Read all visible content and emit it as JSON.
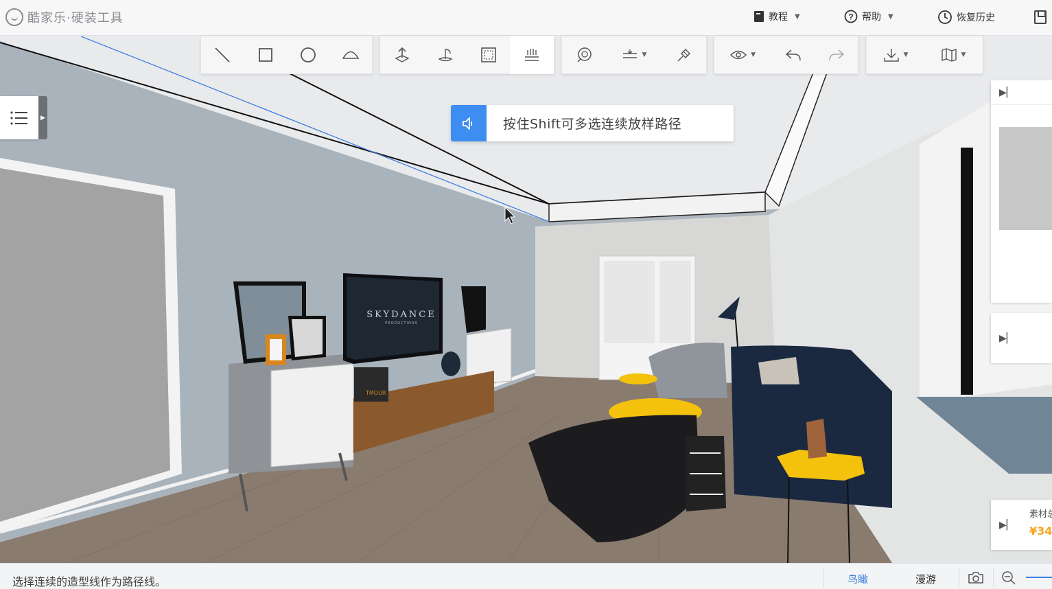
{
  "app": {
    "brand": "酷家乐",
    "dot": "·",
    "tool_name": "硬装工具"
  },
  "top_menu": {
    "tutorial": "教程",
    "help": "帮助",
    "history": "恢复历史"
  },
  "toolbar": {
    "groups": [
      {
        "id": "draw",
        "items": [
          "line-tool-icon",
          "rectangle-tool-icon",
          "circle-tool-icon",
          "arc-tool-icon"
        ]
      },
      {
        "id": "edit",
        "items": [
          "push-pull-icon",
          "rotate-extrude-icon",
          "frame-select-icon",
          "loft-path-icon"
        ]
      },
      {
        "id": "ops",
        "items": [
          "offset-icon",
          "align-dropdown-icon",
          "material-brush-icon"
        ]
      },
      {
        "id": "view",
        "items": [
          "visibility-dropdown-icon",
          "undo-icon",
          "redo-icon"
        ]
      },
      {
        "id": "io",
        "items": [
          "download-dropdown-icon",
          "map-dropdown-icon"
        ]
      }
    ],
    "active_tool": "loft-path-icon"
  },
  "hint": {
    "text": "按住Shift可多选连续放样路径"
  },
  "right_panel": {
    "price_label": "素材总价",
    "price_value": "¥34"
  },
  "status": {
    "message": "选择连续的造型线作为路径线。"
  },
  "view_modes": {
    "bird_eye": "鸟瞰",
    "walk": "漫游",
    "active": "bird_eye"
  },
  "scene": {
    "tv_brand": "SKYDANCE",
    "tv_sub": "PRODUCTIONS",
    "tv_sub2": "TMOUR"
  },
  "colors": {
    "accent": "#3d8ef0",
    "price": "#f5a623"
  }
}
